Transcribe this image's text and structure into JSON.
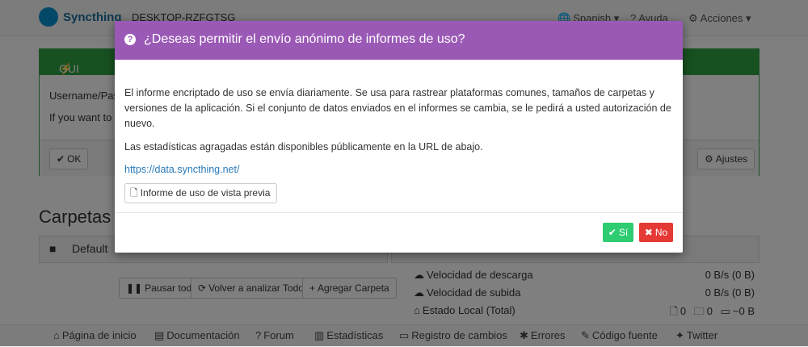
{
  "app": {
    "name": "Syncthing",
    "device": "DESKTOP-RZFGTSG"
  },
  "nav": {
    "language": "Spanish",
    "help": "Ayuda",
    "actions": "Acciones"
  },
  "auth_panel": {
    "title": "GUI Authen",
    "line1": "Username/Pass",
    "line2": "If you want to p",
    "ok_label": "OK",
    "settings_label": "Ajustes"
  },
  "folders": {
    "title": "Carpetas",
    "default_folder": "Default"
  },
  "stats": {
    "download_label": "Velocidad de descarga",
    "download_value": "0 B/s (0 B)",
    "upload_label": "Velocidad de subida",
    "upload_value": "0 B/s (0 B)",
    "local_label": "Estado Local (Total)",
    "local_files": "0",
    "local_dirs": "0",
    "local_size": "~0 B"
  },
  "folder_actions": {
    "pause_all": "Pausar todo",
    "rescan_all": "Volver a analizar Todo",
    "add_folder": "Agregar Carpeta"
  },
  "footer": {
    "home": "Página de inicio",
    "docs": "Documentación",
    "forum": "Forum",
    "stats": "Estadísticas",
    "changelog": "Registro de cambios",
    "errors": "Errores",
    "source": "Código fuente",
    "twitter": "Twitter"
  },
  "modal": {
    "title": "¿Deseas permitir el envío anónimo de informes de uso?",
    "paragraph1": "El informe encriptado de uso se envía diariamente. Se usa para rastrear plataformas comunes, tamaños de carpetas y versiones de la aplicación. Si el conjunto de datos enviados en el informes se cambia, se le pedirá a usted autorización de nuevo.",
    "paragraph2": "Las estadísticas agragadas están disponibles públicamente en la URL de abajo.",
    "link": "https://data.syncthing.net/",
    "preview_button": "Informe de uso de vista previa",
    "yes_button": "Sí",
    "no_button": "No"
  },
  "colors": {
    "header": "#9b59b6",
    "yes": "#2ecc71",
    "no": "#e53935",
    "auth_green": "#2fa043",
    "link": "#2a7ab8"
  }
}
